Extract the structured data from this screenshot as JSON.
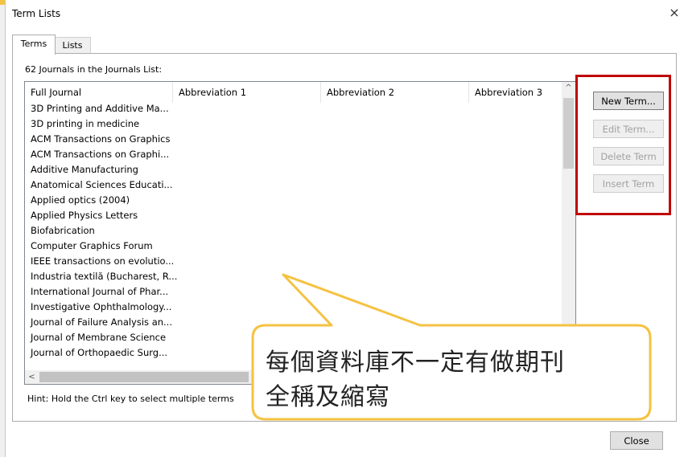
{
  "window": {
    "title": "Term Lists",
    "close_glyph": "×"
  },
  "tabs": [
    {
      "label": "Terms",
      "active": true
    },
    {
      "label": "Lists",
      "active": false
    }
  ],
  "list": {
    "count_label": "62 Journals in the Journals List:",
    "columns": [
      "Full Journal",
      "Abbreviation 1",
      "Abbreviation 2",
      "Abbreviation 3"
    ],
    "rows": [
      "3D Printing and Additive Ma...",
      "3D printing in medicine",
      "ACM Transactions on Graphics",
      "ACM Transactions on Graphi...",
      "Additive Manufacturing",
      "Anatomical Sciences Educati...",
      "Applied optics (2004)",
      "Applied Physics Letters",
      "Biofabrication",
      "Computer Graphics Forum",
      "IEEE transactions on evolutio...",
      "Industria textilă (Bucharest, R...",
      "International Journal of Phar...",
      "Investigative Ophthalmology...",
      "Journal of Failure Analysis an...",
      "Journal of Membrane Science",
      "Journal of Orthopaedic Surg..."
    ],
    "scroll_up_glyph": "^",
    "scroll_left_glyph": "<"
  },
  "buttons": {
    "new_term": "New Term...",
    "edit_term": "Edit Term...",
    "delete_term": "Delete Term",
    "insert_term": "Insert Term",
    "close": "Close"
  },
  "hint": "Hint: Hold the Ctrl key to select multiple terms",
  "callout": {
    "line1": "每個資料庫不一定有做期刊",
    "line2": "全稱及縮寫"
  },
  "colors": {
    "highlight_box": "#c00000",
    "callout_border": "#f5c242"
  }
}
